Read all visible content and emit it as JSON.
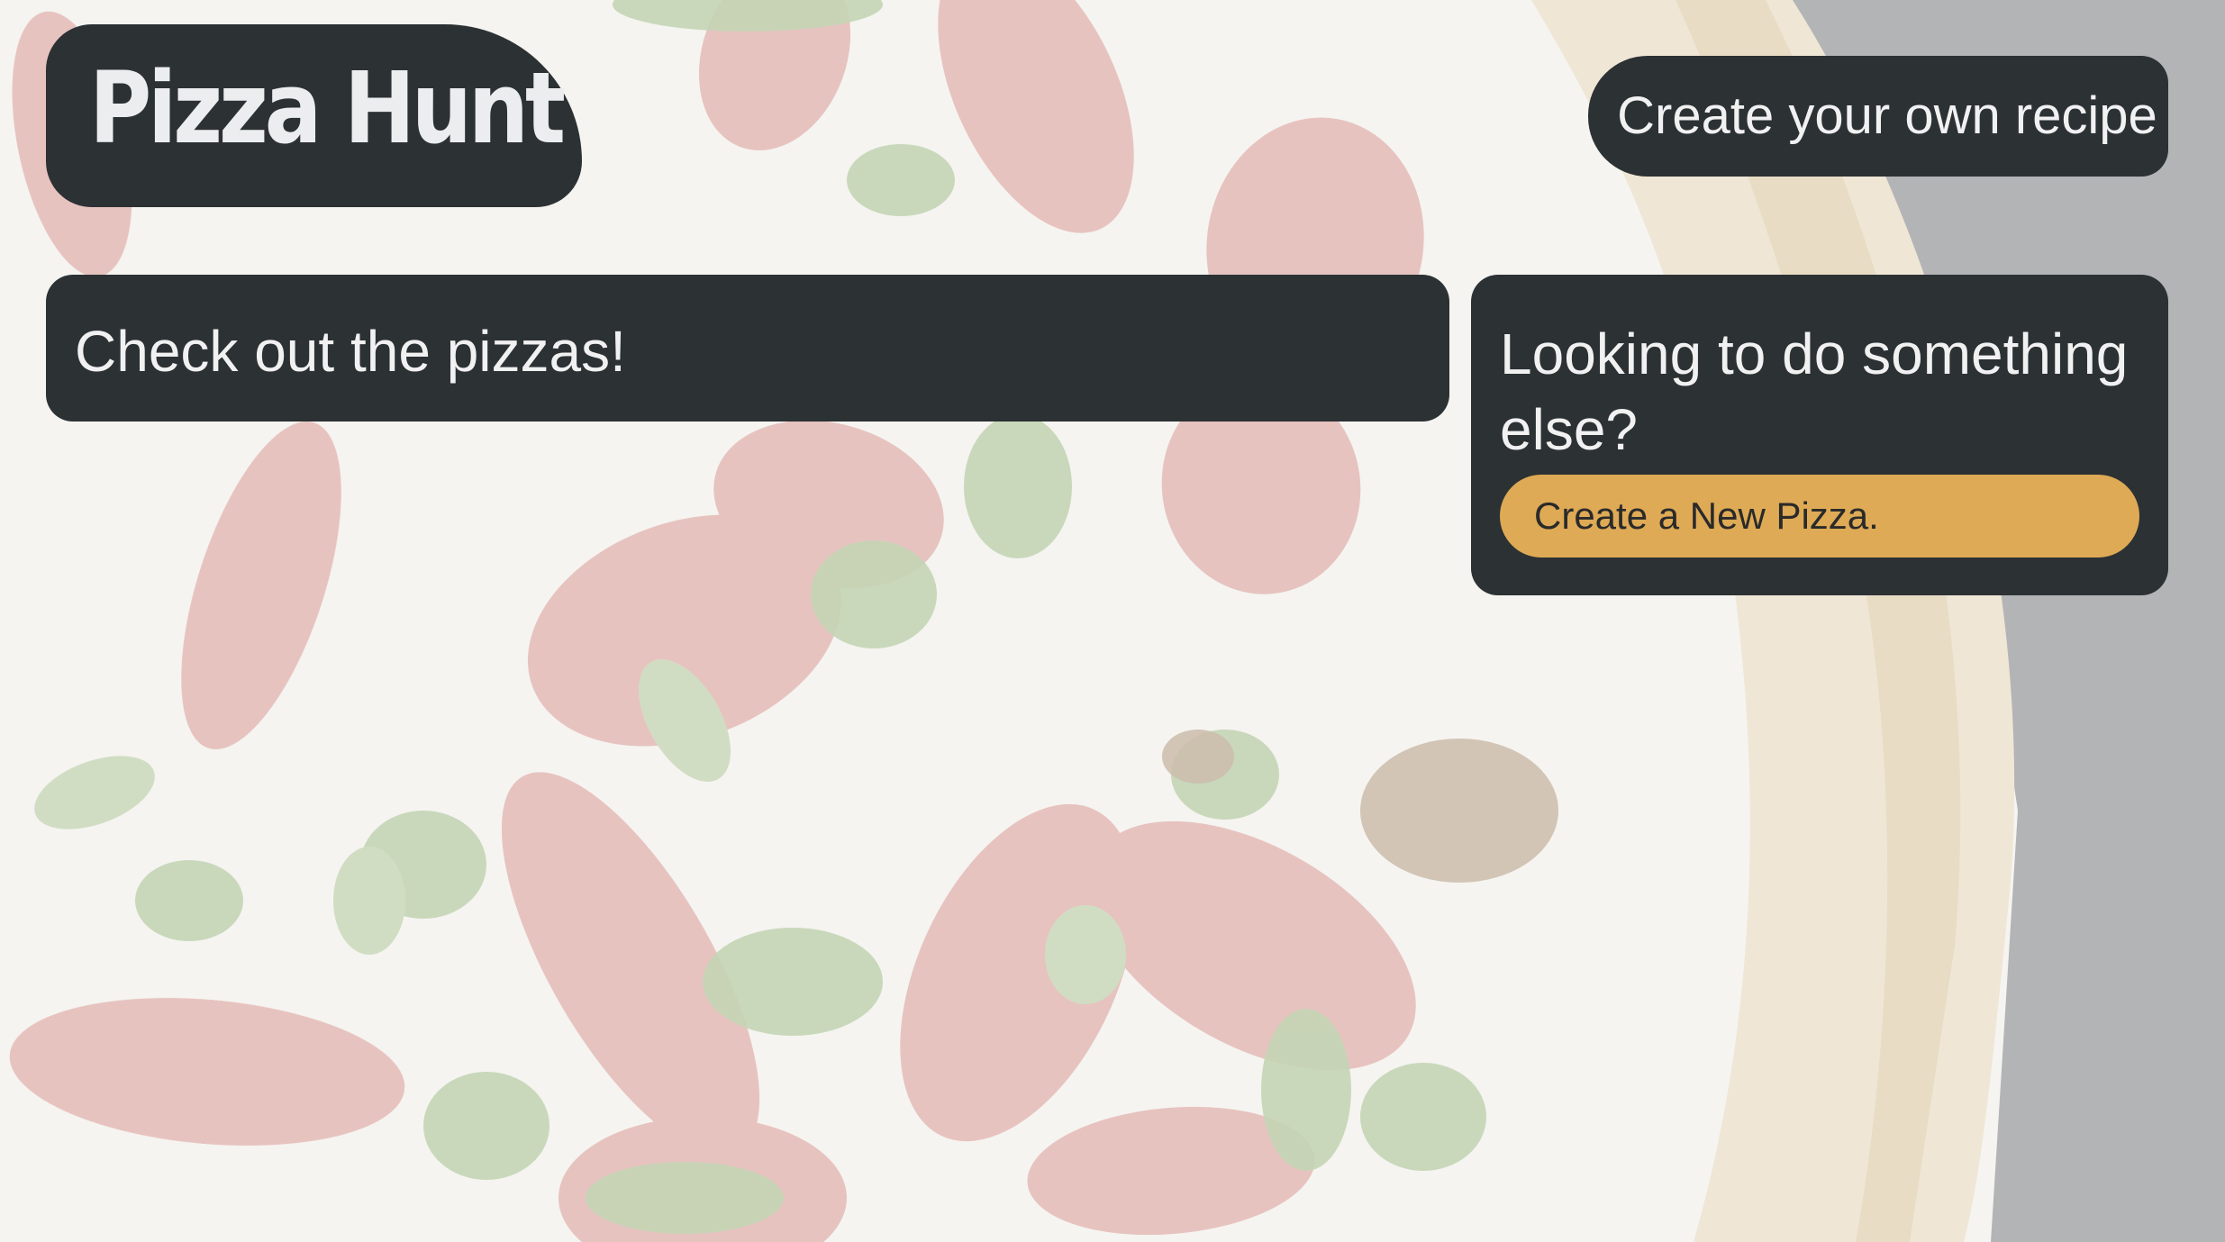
{
  "brand": {
    "logo_text": "Pizza Hunt"
  },
  "nav": {
    "create_recipe_label": "Create your own recipe"
  },
  "main": {
    "title": "Check out the pizzas!"
  },
  "sidebar": {
    "title": "Looking to do something else?",
    "create_button_label": "Create a New Pizza."
  },
  "colors": {
    "panel": "#2c3134",
    "accent": "#deaa55",
    "text_light": "#f1f1f1"
  }
}
